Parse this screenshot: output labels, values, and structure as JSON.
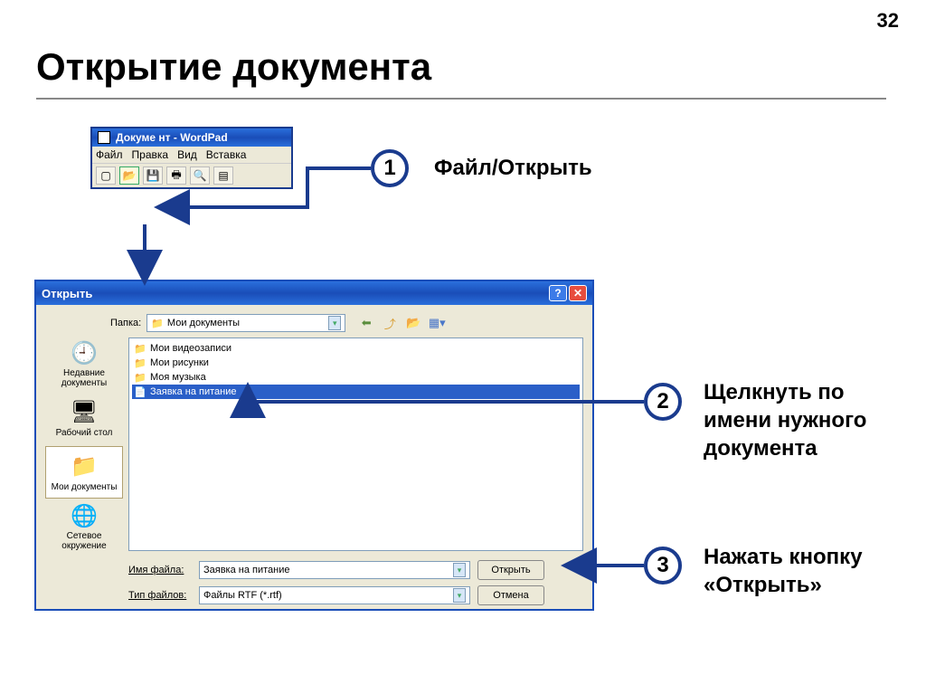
{
  "page_number": "32",
  "title": "Открытие документа",
  "wordpad": {
    "title": "Докуме нт - WordPad",
    "menu": [
      "Файл",
      "Правка",
      "Вид",
      "Вставка"
    ]
  },
  "callouts": [
    {
      "num": "1",
      "text": "Файл/Открыть"
    },
    {
      "num": "2",
      "text": "Щелкнуть по имени нужного документа"
    },
    {
      "num": "3",
      "text": "Нажать кнопку «Открыть»"
    }
  ],
  "open_dialog": {
    "title": "Открыть",
    "folder_label": "Папка:",
    "folder_value": "Мои документы",
    "sidebar": [
      {
        "label": "Недавние документы"
      },
      {
        "label": "Рабочий стол"
      },
      {
        "label": "Мои документы"
      },
      {
        "label": "Сетевое окружение"
      }
    ],
    "files": [
      "Мои видеозаписи",
      "Мои рисунки",
      "Моя музыка",
      "Заявка на питание"
    ],
    "filename_label": "Имя файла:",
    "filename_value": "Заявка на питание",
    "filetype_label": "Тип файлов:",
    "filetype_value": "Файлы RTF (*.rtf)",
    "open_btn": "Открыть",
    "cancel_btn": "Отмена"
  }
}
